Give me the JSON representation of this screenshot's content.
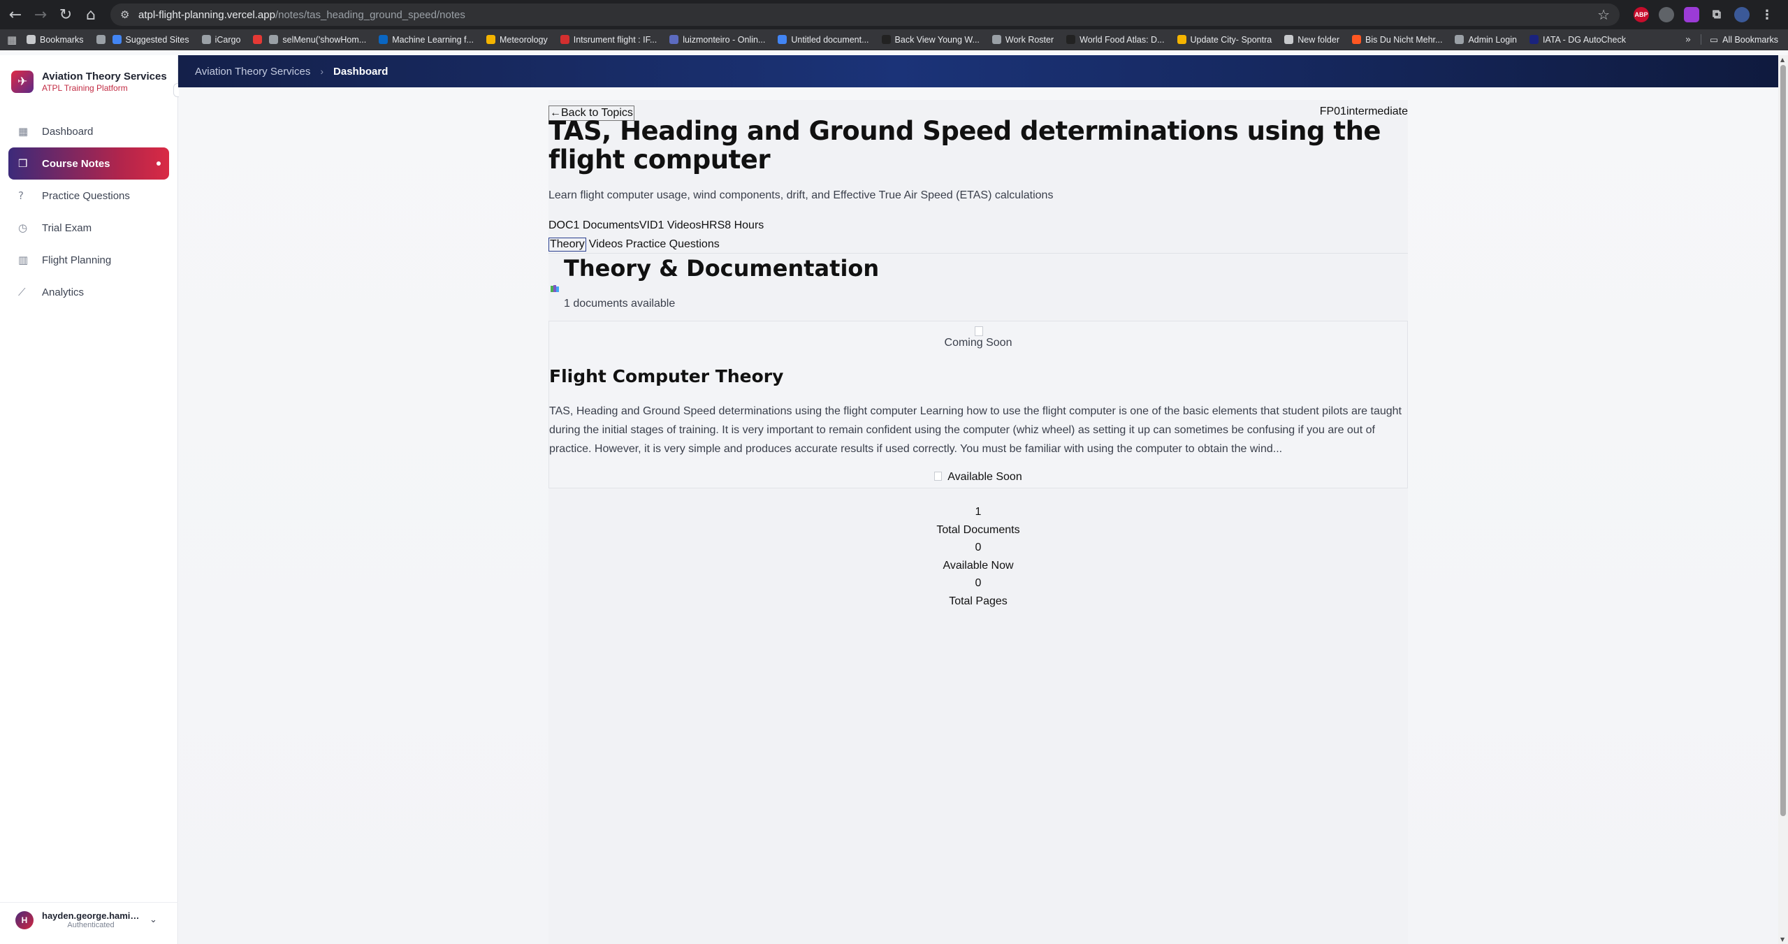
{
  "browser": {
    "url_host": "atpl-flight-planning.vercel.app",
    "url_path": "/notes/tas_heading_ground_speed/notes",
    "bookmarks": [
      {
        "label": "Bookmarks",
        "color": "#c7c9cc"
      },
      {
        "label": "",
        "color": "#9aa0a6"
      },
      {
        "label": "Suggested Sites",
        "color": "#4285f4"
      },
      {
        "label": "iCargo",
        "color": "#9aa0a6"
      },
      {
        "label": "",
        "color": "#e53935"
      },
      {
        "label": "selMenu('showHom...",
        "color": "#9aa0a6"
      },
      {
        "label": "Machine Learning f...",
        "color": "#0a66c2"
      },
      {
        "label": "Meteorology",
        "color": "#f4b400"
      },
      {
        "label": "Intsrument flight : IF...",
        "color": "#d32f2f"
      },
      {
        "label": "luizmonteiro - Onlin...",
        "color": "#5c6bc0"
      },
      {
        "label": "Untitled document...",
        "color": "#4285f4"
      },
      {
        "label": "Back View Young W...",
        "color": "#222222"
      },
      {
        "label": "Work Roster",
        "color": "#9aa0a6"
      },
      {
        "label": "World Food Atlas: D...",
        "color": "#222222"
      },
      {
        "label": "Update City- Spontra",
        "color": "#f4b400"
      },
      {
        "label": "New folder",
        "color": "#c7c9cc"
      },
      {
        "label": "Bis Du Nicht Mehr...",
        "color": "#ff5722"
      },
      {
        "label": "Admin Login",
        "color": "#9aa0a6"
      },
      {
        "label": "IATA - DG AutoCheck",
        "color": "#1a237e"
      }
    ],
    "all_bookmarks": "All Bookmarks"
  },
  "header": {
    "breadcrumb_root": "Aviation Theory Services",
    "breadcrumb_sep": "›",
    "breadcrumb_current": "Dashboard"
  },
  "sidebar": {
    "brand_name": "Aviation Theory Services",
    "brand_sub": "ATPL Training Platform",
    "items": [
      {
        "label": "Dashboard",
        "icon": "grid-icon"
      },
      {
        "label": "Course Notes",
        "icon": "book-icon",
        "active": true
      },
      {
        "label": "Practice Questions",
        "icon": "help-circle-icon"
      },
      {
        "label": "Trial Exam",
        "icon": "clock-icon"
      },
      {
        "label": "Flight Planning",
        "icon": "map-icon"
      },
      {
        "label": "Analytics",
        "icon": "chart-icon"
      }
    ],
    "user": {
      "initial": "H",
      "name": "hayden.george.hamilt...",
      "status": "Authenticated"
    }
  },
  "topic": {
    "back_label": "←Back to Topics",
    "meta": "FP01intermediate",
    "title": "TAS, Heading and Ground Speed determinations using the flight computer",
    "description": "Learn flight computer usage, wind components, drift, and Effective True Air Speed (ETAS) calculations",
    "stats": "DOC1 DocumentsVID1 VideosHRS8 Hours",
    "tabs": [
      "Theory",
      "Videos",
      "Practice Questions"
    ]
  },
  "section": {
    "heading": "Theory & Documentation",
    "docs_available": "1 documents available"
  },
  "document": {
    "status": "Coming Soon",
    "title": "Flight Computer Theory",
    "excerpt": "TAS, Heading and Ground Speed determinations using the flight computer Learning how to use the flight computer is one of the basic elements that student pilots are taught during the initial stages of training. It is very important to remain confident using the computer (whiz wheel) as setting it up can sometimes be confusing if you are out of practice. However, it is very simple and produces accurate results if used correctly. You must be familiar with using the computer to obtain the wind...",
    "availability": "Available Soon"
  },
  "summary": {
    "total_documents_value": "1",
    "total_documents_label": "Total Documents",
    "available_now_value": "0",
    "available_now_label": "Available Now",
    "total_pages_value": "0",
    "total_pages_label": "Total Pages"
  }
}
